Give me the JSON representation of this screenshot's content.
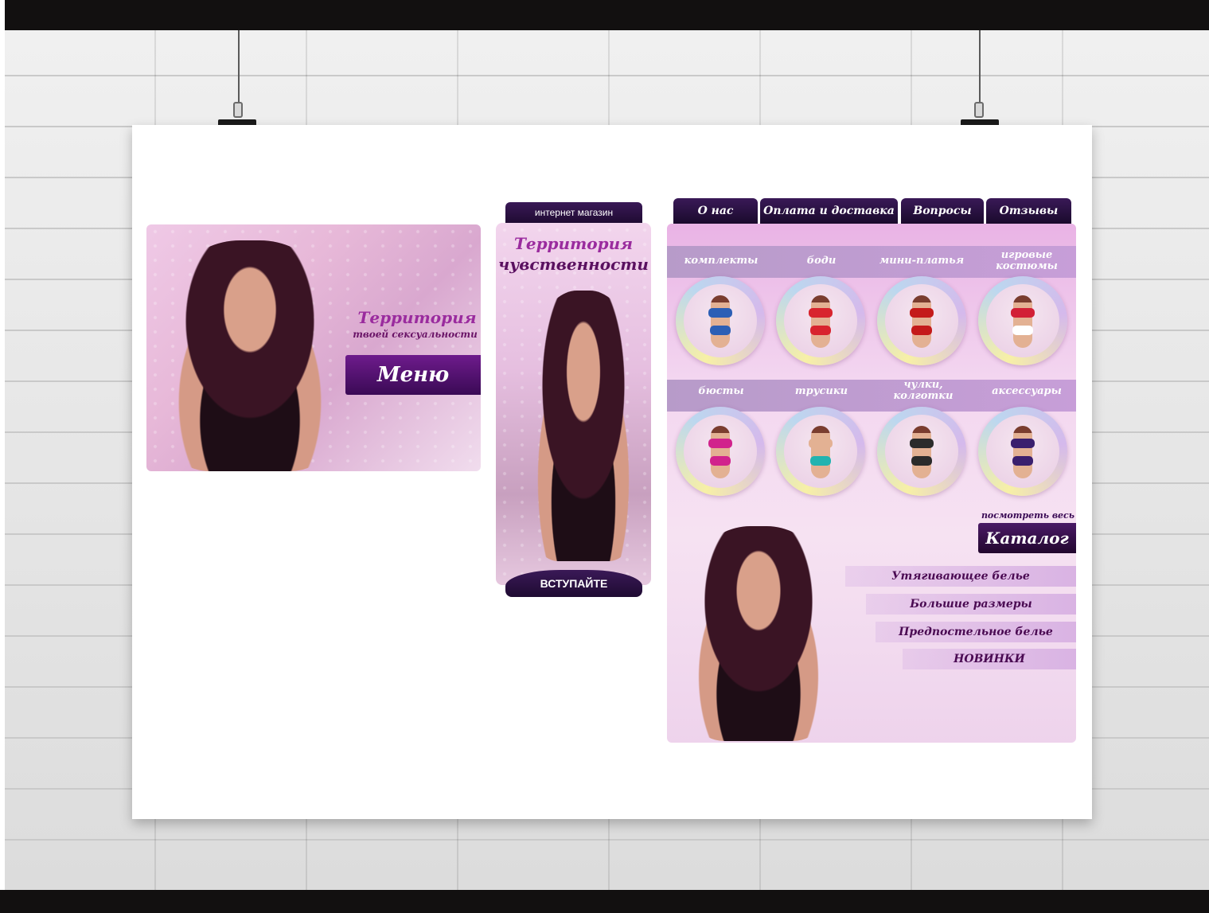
{
  "poster": {
    "banner_menu": {
      "title": "Территория",
      "subtitle": "твоей сексуальности",
      "button_label": "Меню"
    },
    "banner_join": {
      "tab_label": "интернет магазин",
      "title_line1": "Территория",
      "title_line2": "чувственности",
      "button_label": "ВСТУПАЙТЕ"
    },
    "shop_menu": {
      "nav_tabs": [
        "О нас",
        "Оплата и доставка",
        "Вопросы",
        "Отзывы"
      ],
      "categories_row1": [
        {
          "label": "комплекты",
          "accent": "#2c5fb5"
        },
        {
          "label": "боди",
          "accent": "#d8242e"
        },
        {
          "label": "мини-платья",
          "accent": "#c41a1a"
        },
        {
          "label": "игровые костюмы",
          "accent": "#d21f36"
        }
      ],
      "categories_row2": [
        {
          "label": "бюсты",
          "accent": "#d1238c"
        },
        {
          "label": "трусики",
          "accent": "#22b3b0"
        },
        {
          "label": "чулки, колготки",
          "accent": "#2b2b2b"
        },
        {
          "label": "аксессуары",
          "accent": "#3a1f6e"
        }
      ],
      "see_all": "посмотреть весь",
      "catalog_button": "Каталог",
      "links": [
        "Утягивающее белье",
        "Большие размеры",
        "Предпостельное белье",
        "НОВИНКИ"
      ]
    }
  }
}
